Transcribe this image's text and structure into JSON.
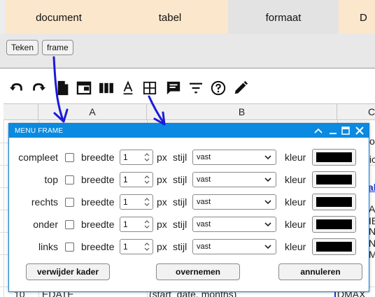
{
  "tabs": [
    {
      "label": "document"
    },
    {
      "label": "tabel"
    },
    {
      "label": "formaat"
    },
    {
      "label": "D"
    }
  ],
  "subbar": {
    "buttons": [
      {
        "label": "Teken"
      },
      {
        "label": "frame"
      }
    ]
  },
  "toolbar": {
    "icons": [
      "undo-icon",
      "redo-icon",
      "document-icon",
      "window-icon",
      "columns-icon",
      "text-color-icon",
      "grid-border-icon",
      "comment-icon",
      "filter-icon",
      "help-icon",
      "pencil-icon"
    ]
  },
  "sheet": {
    "columns": [
      "A",
      "B",
      "C"
    ],
    "cells": {
      "c_row1": "ou",
      "c_row2": "ic",
      "c_row3": "ab",
      "c_row4": "AI",
      "c_row5": "IE",
      "c_row6": "N",
      "c_row7": "N",
      "c_row8": "M",
      "row10_num": "10",
      "row10_a": "EDATE",
      "row10_b": "(start_date, months)",
      "row10_c": "DMAX"
    }
  },
  "dialog": {
    "title": "MENU FRAME",
    "rows": [
      {
        "label": "compleet",
        "width_label": "breedte",
        "width_value": "1",
        "unit": "px",
        "style_label": "stijl",
        "style_value": "vast",
        "color_label": "kleur",
        "color": "#000000"
      },
      {
        "label": "top",
        "width_label": "breedte",
        "width_value": "1",
        "unit": "px",
        "style_label": "stijl",
        "style_value": "vast",
        "color_label": "kleur",
        "color": "#000000"
      },
      {
        "label": "rechts",
        "width_label": "breedte",
        "width_value": "1",
        "unit": "px",
        "style_label": "stijl",
        "style_value": "vast",
        "color_label": "kleur",
        "color": "#000000"
      },
      {
        "label": "onder",
        "width_label": "breedte",
        "width_value": "1",
        "unit": "px",
        "style_label": "stijl",
        "style_value": "vast",
        "color_label": "kleur",
        "color": "#000000"
      },
      {
        "label": "links",
        "width_label": "breedte",
        "width_value": "1",
        "unit": "px",
        "style_label": "stijl",
        "style_value": "vast",
        "color_label": "kleur",
        "color": "#000000"
      }
    ],
    "buttons": {
      "remove": "verwijder kader",
      "apply": "overnemen",
      "cancel": "annuleren"
    }
  },
  "colors": {
    "accent": "#0a8ae0",
    "tab_bg": "#fbe7cc",
    "tab_active_bg": "#e3e3e3",
    "annotation": "#1a1adc"
  }
}
